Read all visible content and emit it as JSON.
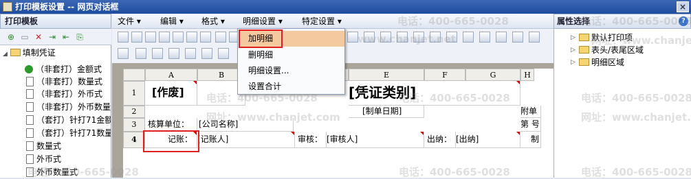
{
  "window": {
    "title": "打印模板设置 -- 网页对话框",
    "close_symbol": "×"
  },
  "left_panel": {
    "header": "打印模板",
    "toolbar_icons": [
      "new-doc-icon",
      "save-icon",
      "delete-icon",
      "import-icon",
      "export-icon",
      "copy-icon"
    ],
    "tree": {
      "root": "填制凭证",
      "items": [
        "（非套打）金额式",
        "（非套打）数量式",
        "（非套打）外币式",
        "（非套打）外币数量",
        "（套打）针打71金额",
        "（套打）针打71数量",
        "数量式",
        "外币式",
        "外币数量式"
      ]
    }
  },
  "menu": {
    "items": [
      "文件",
      "编辑",
      "格式",
      "明细设置",
      "特定设置"
    ]
  },
  "dropdown": {
    "items": [
      "加明细",
      "删明细",
      "明细设置...",
      "设置合计"
    ]
  },
  "sheet": {
    "columns": [
      "A",
      "B",
      "C",
      "D",
      "E",
      "F",
      "G",
      "H"
    ],
    "rows": [
      "1",
      "2",
      "3",
      "4"
    ],
    "cells": {
      "r1_void": "[作废]",
      "r1_title": "[凭证类别]",
      "r2_date": "[制单日期]",
      "r2_attach": "附单",
      "r3_unit_label": "核算单位：",
      "r3_unit_value": "[公司名称]",
      "r3_page": "第 号",
      "r4_bookkeeper_label": "记账：",
      "r4_bookkeeper_value": "[记账人]",
      "r4_review_label": "审核：",
      "r4_review_value": "[审核人]",
      "r4_cashier_label": "出纳：",
      "r4_cashier_value": "[出纳]",
      "r4_maker": "制"
    }
  },
  "right_panel": {
    "header": "属性选择",
    "help_symbol": "?",
    "tree": [
      "默认打印项",
      "表头/表尾区域",
      "明细区域"
    ]
  },
  "watermarks": {
    "phone": "电话：400-665-0028",
    "site": "网址：www.chanjet.com",
    "site_short": "www.chanjet.net"
  },
  "colors": {
    "highlight": "#e02020",
    "title_bg": "#2a56a8",
    "selected_item_bg": "#f5c9a0"
  }
}
